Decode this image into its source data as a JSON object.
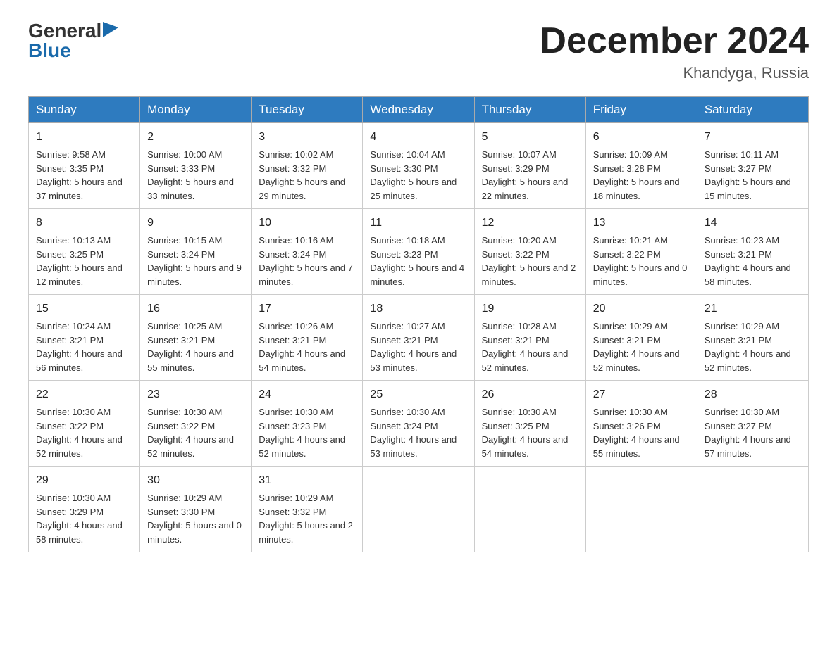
{
  "header": {
    "logo_general": "General",
    "logo_blue": "Blue",
    "month_year": "December 2024",
    "location": "Khandyga, Russia"
  },
  "days_of_week": [
    "Sunday",
    "Monday",
    "Tuesday",
    "Wednesday",
    "Thursday",
    "Friday",
    "Saturday"
  ],
  "weeks": [
    [
      {
        "day": "1",
        "sunrise": "9:58 AM",
        "sunset": "3:35 PM",
        "daylight": "5 hours and 37 minutes."
      },
      {
        "day": "2",
        "sunrise": "10:00 AM",
        "sunset": "3:33 PM",
        "daylight": "5 hours and 33 minutes."
      },
      {
        "day": "3",
        "sunrise": "10:02 AM",
        "sunset": "3:32 PM",
        "daylight": "5 hours and 29 minutes."
      },
      {
        "day": "4",
        "sunrise": "10:04 AM",
        "sunset": "3:30 PM",
        "daylight": "5 hours and 25 minutes."
      },
      {
        "day": "5",
        "sunrise": "10:07 AM",
        "sunset": "3:29 PM",
        "daylight": "5 hours and 22 minutes."
      },
      {
        "day": "6",
        "sunrise": "10:09 AM",
        "sunset": "3:28 PM",
        "daylight": "5 hours and 18 minutes."
      },
      {
        "day": "7",
        "sunrise": "10:11 AM",
        "sunset": "3:27 PM",
        "daylight": "5 hours and 15 minutes."
      }
    ],
    [
      {
        "day": "8",
        "sunrise": "10:13 AM",
        "sunset": "3:25 PM",
        "daylight": "5 hours and 12 minutes."
      },
      {
        "day": "9",
        "sunrise": "10:15 AM",
        "sunset": "3:24 PM",
        "daylight": "5 hours and 9 minutes."
      },
      {
        "day": "10",
        "sunrise": "10:16 AM",
        "sunset": "3:24 PM",
        "daylight": "5 hours and 7 minutes."
      },
      {
        "day": "11",
        "sunrise": "10:18 AM",
        "sunset": "3:23 PM",
        "daylight": "5 hours and 4 minutes."
      },
      {
        "day": "12",
        "sunrise": "10:20 AM",
        "sunset": "3:22 PM",
        "daylight": "5 hours and 2 minutes."
      },
      {
        "day": "13",
        "sunrise": "10:21 AM",
        "sunset": "3:22 PM",
        "daylight": "5 hours and 0 minutes."
      },
      {
        "day": "14",
        "sunrise": "10:23 AM",
        "sunset": "3:21 PM",
        "daylight": "4 hours and 58 minutes."
      }
    ],
    [
      {
        "day": "15",
        "sunrise": "10:24 AM",
        "sunset": "3:21 PM",
        "daylight": "4 hours and 56 minutes."
      },
      {
        "day": "16",
        "sunrise": "10:25 AM",
        "sunset": "3:21 PM",
        "daylight": "4 hours and 55 minutes."
      },
      {
        "day": "17",
        "sunrise": "10:26 AM",
        "sunset": "3:21 PM",
        "daylight": "4 hours and 54 minutes."
      },
      {
        "day": "18",
        "sunrise": "10:27 AM",
        "sunset": "3:21 PM",
        "daylight": "4 hours and 53 minutes."
      },
      {
        "day": "19",
        "sunrise": "10:28 AM",
        "sunset": "3:21 PM",
        "daylight": "4 hours and 52 minutes."
      },
      {
        "day": "20",
        "sunrise": "10:29 AM",
        "sunset": "3:21 PM",
        "daylight": "4 hours and 52 minutes."
      },
      {
        "day": "21",
        "sunrise": "10:29 AM",
        "sunset": "3:21 PM",
        "daylight": "4 hours and 52 minutes."
      }
    ],
    [
      {
        "day": "22",
        "sunrise": "10:30 AM",
        "sunset": "3:22 PM",
        "daylight": "4 hours and 52 minutes."
      },
      {
        "day": "23",
        "sunrise": "10:30 AM",
        "sunset": "3:22 PM",
        "daylight": "4 hours and 52 minutes."
      },
      {
        "day": "24",
        "sunrise": "10:30 AM",
        "sunset": "3:23 PM",
        "daylight": "4 hours and 52 minutes."
      },
      {
        "day": "25",
        "sunrise": "10:30 AM",
        "sunset": "3:24 PM",
        "daylight": "4 hours and 53 minutes."
      },
      {
        "day": "26",
        "sunrise": "10:30 AM",
        "sunset": "3:25 PM",
        "daylight": "4 hours and 54 minutes."
      },
      {
        "day": "27",
        "sunrise": "10:30 AM",
        "sunset": "3:26 PM",
        "daylight": "4 hours and 55 minutes."
      },
      {
        "day": "28",
        "sunrise": "10:30 AM",
        "sunset": "3:27 PM",
        "daylight": "4 hours and 57 minutes."
      }
    ],
    [
      {
        "day": "29",
        "sunrise": "10:30 AM",
        "sunset": "3:29 PM",
        "daylight": "4 hours and 58 minutes."
      },
      {
        "day": "30",
        "sunrise": "10:29 AM",
        "sunset": "3:30 PM",
        "daylight": "5 hours and 0 minutes."
      },
      {
        "day": "31",
        "sunrise": "10:29 AM",
        "sunset": "3:32 PM",
        "daylight": "5 hours and 2 minutes."
      },
      null,
      null,
      null,
      null
    ]
  ]
}
